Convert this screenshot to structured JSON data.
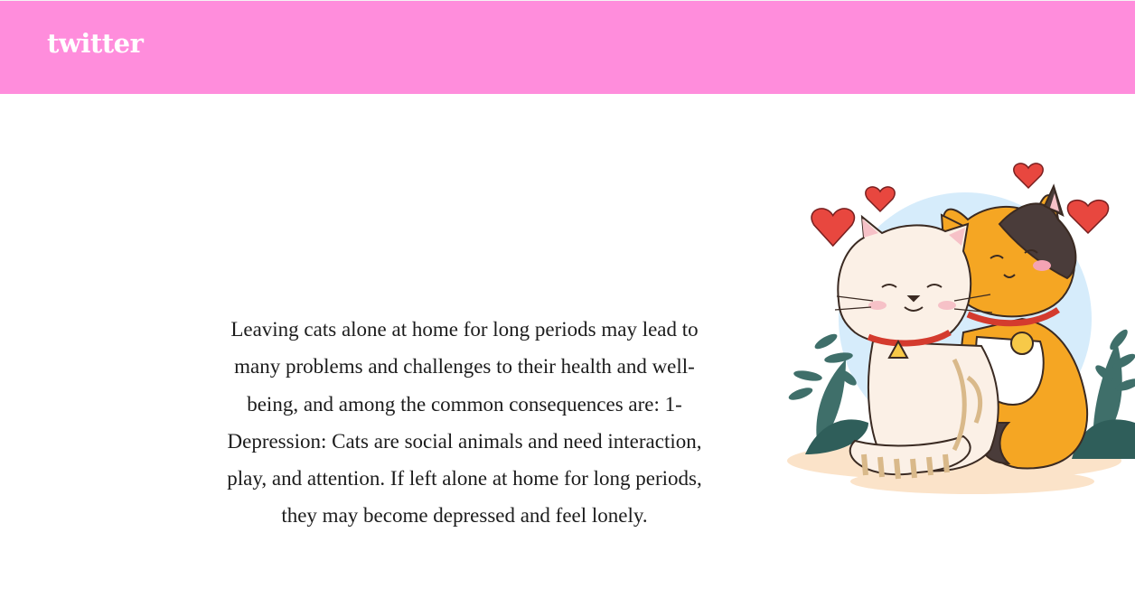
{
  "header": {
    "brand": "twitter",
    "background_color": "#ff8ddc"
  },
  "main": {
    "paragraph": "Leaving cats alone at home for long periods may lead to many problems and challenges to their health and well-being, and among the common consequences are: 1- Depression: Cats are social animals and need interaction, play, and attention. If left alone at home for long periods, they may become depressed and feel lonely.",
    "illustration": "two-cats-cuddling-with-hearts"
  }
}
